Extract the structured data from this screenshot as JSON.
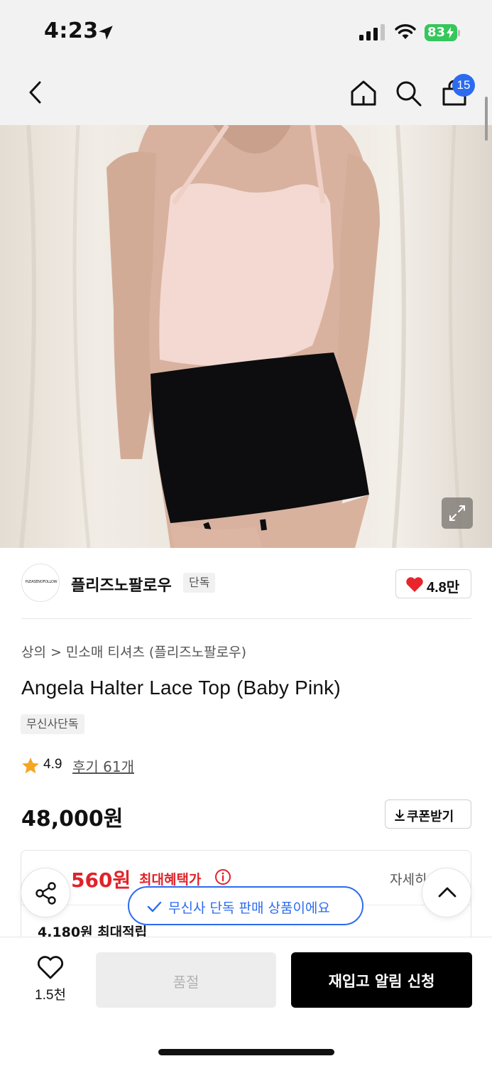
{
  "status_bar": {
    "time": "4:23",
    "battery": "83"
  },
  "nav": {
    "cart_count": "15"
  },
  "brand": {
    "logo_text": "PLEASENOFOLLOW",
    "name": "플리즈노팔로우",
    "exclusive_tag": "단독",
    "likes": "4.8만"
  },
  "breadcrumb": {
    "category": "상의",
    "separator": ">",
    "subcategory": "민소매 티셔츠 (플리즈노팔로우)"
  },
  "product": {
    "title": "Angela Halter Lace Top (Baby Pink)",
    "tag": "무신사단독",
    "rating": "4.9",
    "reviews": "후기 61개",
    "price": "48,000원"
  },
  "coupon": {
    "label": "쿠폰받기"
  },
  "benefit": {
    "price": "560원",
    "label": "최대혜택가",
    "detail": "자세히",
    "points": "4,180원 최대적립"
  },
  "toast": {
    "exclusive": "무신사 단독 판매 상품이에요"
  },
  "bottom": {
    "wish_count": "1.5천",
    "soldout": "품절",
    "restock": "재입고 알림 신청"
  },
  "colors": {
    "accent_blue": "#2c6bf0",
    "sale_red": "#e0232a",
    "heart_red": "#e8242c",
    "star_orange": "#f5a623"
  }
}
